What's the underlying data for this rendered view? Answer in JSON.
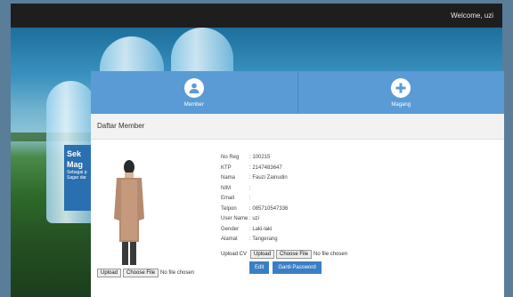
{
  "topbar": {
    "welcome": "Welcome, uzi"
  },
  "promo": {
    "title1": "Sek",
    "title2": "Mag",
    "line1": "Sebagai p",
    "line2": "Sagar dar"
  },
  "nav": [
    {
      "label": "Member",
      "icon": "user-icon"
    },
    {
      "label": "Magang",
      "icon": "plus-icon"
    }
  ],
  "section": {
    "title": "Daftar Member"
  },
  "member": {
    "rows": [
      {
        "label": "No Reg",
        "value": ": 100215"
      },
      {
        "label": "KTP",
        "value": ": 2147483647"
      },
      {
        "label": "Nama",
        "value": ": Fauzi Zainudin"
      },
      {
        "label": "NIM",
        "value": ":"
      },
      {
        "label": "Email",
        "value": ":"
      },
      {
        "label": "Telpon",
        "value": ": 085710547336"
      },
      {
        "label": "User Name",
        "value": ": uzi"
      },
      {
        "label": "Gender",
        "value": ": Laki-laki"
      },
      {
        "label": "Alamat",
        "value": ": Tangerang"
      }
    ]
  },
  "photo_upload": {
    "upload": "Upload",
    "choose": "Choose File",
    "status": "No file chosen"
  },
  "cv_upload": {
    "label": "Upload CV",
    "upload": "Upload",
    "choose": "Choose File",
    "status": "No file chosen"
  },
  "actions": {
    "edit": "Edit",
    "change_password": "Ganti Password"
  }
}
